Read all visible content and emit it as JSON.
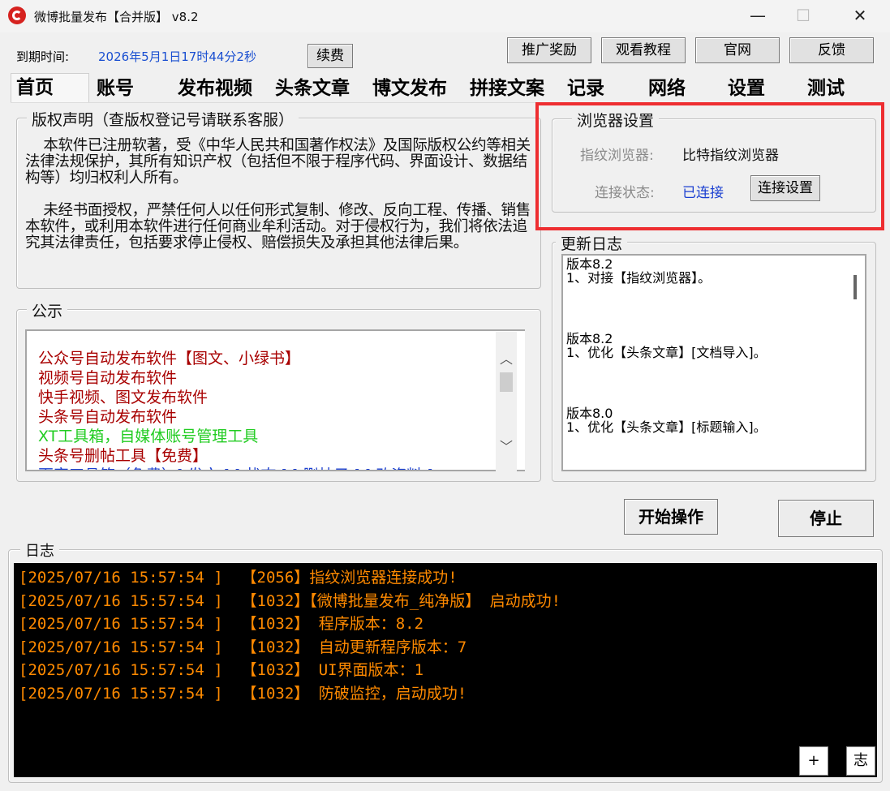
{
  "window": {
    "title": "微博批量发布【合并版】  v8.2",
    "controls": {
      "minimize": "—",
      "maximize": "☐",
      "close": "✕"
    }
  },
  "expiry": {
    "label": "到期时间:",
    "value": "2026年5月1日17时44分2秒",
    "renew_button": "续费"
  },
  "top_buttons": [
    "推广奖励",
    "观看教程",
    "官网",
    "反馈"
  ],
  "tabs": [
    "首页",
    "账号",
    "发布视频",
    "头条文章",
    "博文发布",
    "拼接文案",
    "记录",
    "网络",
    "设置",
    "测试"
  ],
  "active_tab": "首页",
  "copyright": {
    "title": "版权声明（查版权登记号请联系客服）",
    "paragraph1": "    本软件已注册软著，受《中华人民共和国著作权法》及国际版权公约等相关法律法规保护，其所有知识产权（包括但不限于程序代码、界面设计、数据结构等）均归权利人所有。",
    "paragraph2": "    未经书面授权，严禁任何人以任何形式复制、修改、反向工程、传播、销售本软件，或利用本软件进行任何商业牟利活动。对于侵权行为，我们将依法追究其法律责任，包括要求停止侵权、赔偿损失及承担其他法律后果。"
  },
  "notice": {
    "title": "公示",
    "items": [
      {
        "text": "公众号自动发布软件【图文、小绿书】",
        "color": "#a80000"
      },
      {
        "text": "视频号自动发布软件",
        "color": "#a80000"
      },
      {
        "text": "快手视频、图文发布软件",
        "color": "#a80000"
      },
      {
        "text": "头条号自动发布软件",
        "color": "#a80000"
      },
      {
        "text": "XT工具箱，自媒体账号管理工具",
        "color": "#22cc22"
      },
      {
        "text": "头条号删帖工具【免费】",
        "color": "#a80000"
      },
      {
        "text": "百家工具箱（免费）[ 发文 ] [ 状态 ] [ 删帖子 ] [ 改资料 ]",
        "color": "#1a3fd1"
      }
    ]
  },
  "browser_settings": {
    "title": "浏览器设置",
    "browser_label": "指纹浏览器:",
    "browser_value": "比特指纹浏览器",
    "status_label": "连接状态:",
    "status_value": "已连接",
    "connect_button": "连接设置"
  },
  "update_log": {
    "title": "更新日志",
    "entries": [
      {
        "version": "版本8.2",
        "note": "1、对接【指纹浏览器】。"
      },
      {
        "version": "版本8.2",
        "note": "1、优化【头条文章】[文档导入]。"
      },
      {
        "version": "版本8.0",
        "note": "1、优化【头条文章】[标题输入]。"
      }
    ]
  },
  "actions": {
    "start": "开始操作",
    "stop": "停止"
  },
  "log": {
    "title": "日志",
    "lines": [
      "[2025/07/16 15:57:54 ]  【2056】指纹浏览器连接成功!",
      "[2025/07/16 15:57:54 ]  【1032】【微博批量发布_纯净版】 启动成功!",
      "[2025/07/16 15:57:54 ]  【1032】 程序版本：8.2",
      "[2025/07/16 15:57:54 ]  【1032】 自动更新程序版本：7",
      "[2025/07/16 15:57:54 ]  【1032】 UI界面版本：1",
      "[2025/07/16 15:57:54 ]  【1032】 防破监控，启动成功!"
    ],
    "plus_button": "+",
    "log_button": "志"
  },
  "colors": {
    "accent_blue": "#1a4fd1",
    "highlight_red": "#ee2e31",
    "console_text": "#ff8a00"
  }
}
